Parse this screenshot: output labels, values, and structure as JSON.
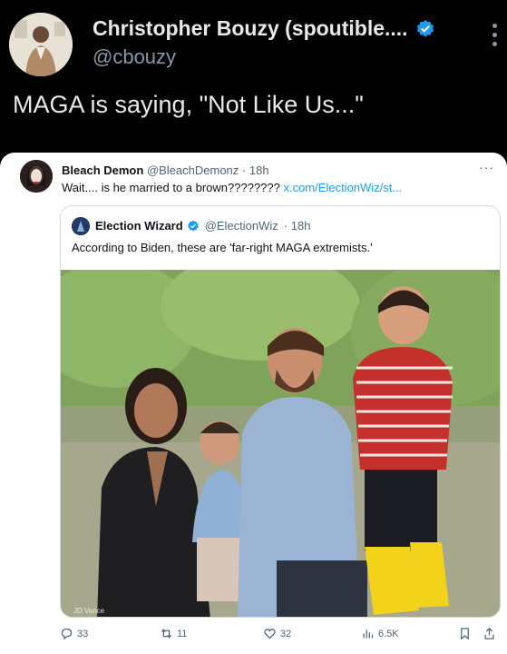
{
  "outer_post": {
    "author_name": "Christopher Bouzy (spoutible....",
    "handle": "@cbouzy",
    "text": "MAGA is saying, \"Not Like Us...\""
  },
  "embedded_post": {
    "author_name": "Bleach Demon",
    "handle": "@BleachDemonz",
    "time": "· 18h",
    "text": "Wait.... is he married to a brown????????",
    "link": "x.com/ElectionWiz/st..."
  },
  "quoted_post": {
    "author_name": "Election Wizard",
    "handle": "@ElectionWiz",
    "time": "· 18h",
    "text": "According to Biden, these are 'far-right MAGA extremists.'"
  },
  "actions": {
    "replies": "33",
    "reposts": "11",
    "likes": "32",
    "views": "6.5K"
  },
  "colors": {
    "verified": "#1d9bf0",
    "link": "#1d9bf0",
    "muted": "#536471"
  },
  "icons": [
    "verified-badge-icon",
    "more-vertical-icon",
    "more-horizontal-icon",
    "reply-icon",
    "repost-icon",
    "like-icon",
    "views-icon",
    "bookmark-icon",
    "share-icon"
  ]
}
